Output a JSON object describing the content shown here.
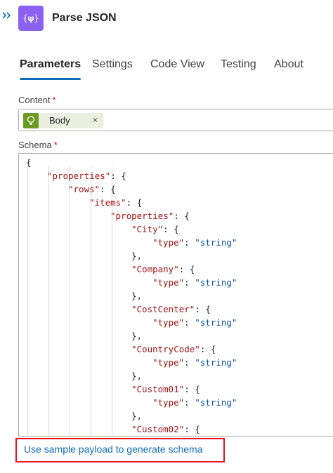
{
  "header": {
    "title": "Parse JSON",
    "icon_glyph": "{𝛙}",
    "icon_color": "#8a61f0"
  },
  "tabs": [
    {
      "label": "Parameters",
      "active": true
    },
    {
      "label": "Settings"
    },
    {
      "label": "Code View"
    },
    {
      "label": "Testing"
    },
    {
      "label": "About"
    }
  ],
  "content_field": {
    "label": "Content",
    "required_mark": "*",
    "token": {
      "label": "Body",
      "close": "×",
      "icon": "lightbulb-icon",
      "color": "#6b9a24"
    }
  },
  "schema_field": {
    "label": "Schema",
    "required_mark": "*",
    "lines": [
      {
        "indent": 0,
        "key": "",
        "rest": "{"
      },
      {
        "indent": 1,
        "key": "\"properties\"",
        "rest": ": {"
      },
      {
        "indent": 2,
        "key": "\"rows\"",
        "rest": ": {"
      },
      {
        "indent": 3,
        "key": "\"items\"",
        "rest": ": {"
      },
      {
        "indent": 4,
        "key": "\"properties\"",
        "rest": ": {"
      },
      {
        "indent": 5,
        "key": "\"City\"",
        "rest": ": {"
      },
      {
        "indent": 6,
        "key": "\"type\"",
        "rest": ": ",
        "value": "\"string\""
      },
      {
        "indent": 5,
        "key": "",
        "rest": "},"
      },
      {
        "indent": 5,
        "key": "\"Company\"",
        "rest": ": {"
      },
      {
        "indent": 6,
        "key": "\"type\"",
        "rest": ": ",
        "value": "\"string\""
      },
      {
        "indent": 5,
        "key": "",
        "rest": "},"
      },
      {
        "indent": 5,
        "key": "\"CostCenter\"",
        "rest": ": {"
      },
      {
        "indent": 6,
        "key": "\"type\"",
        "rest": ": ",
        "value": "\"string\""
      },
      {
        "indent": 5,
        "key": "",
        "rest": "},"
      },
      {
        "indent": 5,
        "key": "\"CountryCode\"",
        "rest": ": {"
      },
      {
        "indent": 6,
        "key": "\"type\"",
        "rest": ": ",
        "value": "\"string\""
      },
      {
        "indent": 5,
        "key": "",
        "rest": "},"
      },
      {
        "indent": 5,
        "key": "\"Custom01\"",
        "rest": ": {"
      },
      {
        "indent": 6,
        "key": "\"type\"",
        "rest": ": ",
        "value": "\"string\""
      },
      {
        "indent": 5,
        "key": "",
        "rest": "},"
      },
      {
        "indent": 5,
        "key": "\"Custom02\"",
        "rest": ": {"
      }
    ]
  },
  "sample_payload_link": "Use sample payload to generate schema",
  "colors": {
    "accent": "#0f6cbd",
    "highlight_frame": "#e8121a",
    "json_key": "#a31515",
    "json_value": "#0451a5"
  }
}
